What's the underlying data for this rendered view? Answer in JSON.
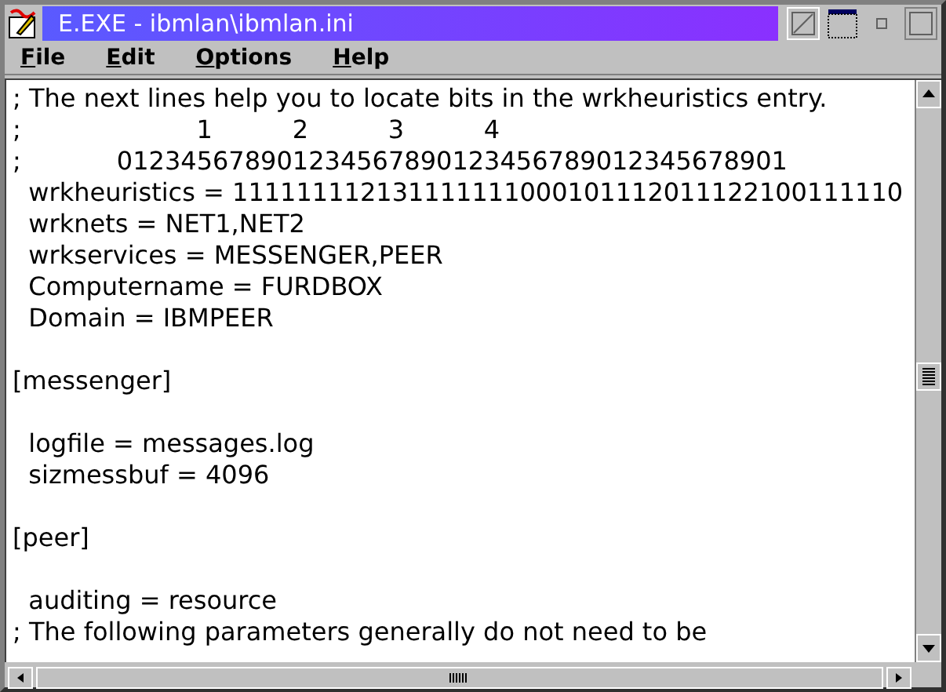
{
  "window": {
    "title": "E.EXE - ibmlan\\ibmlan.ini"
  },
  "menu": [
    "File",
    "Edit",
    "Options",
    "Help"
  ],
  "lines": [
    {
      "kind": "text",
      "text": "; The next lines help you to locate bits in the wrkheuristics entry."
    },
    {
      "kind": "text",
      "text": ";                      1          2          3          4"
    },
    {
      "kind": "text",
      "text": ";            012345678901234567890123456789012345678901"
    },
    {
      "kind": "text",
      "text": "  wrkheuristics = 111111112131111111000101112011122100111110"
    },
    {
      "kind": "text",
      "text": "  wrknets = NET1,NET2"
    },
    {
      "kind": "text",
      "text": "  wrkservices = MESSENGER,PEER"
    },
    {
      "kind": "text",
      "text": "  Computername = FURDBOX"
    },
    {
      "kind": "text",
      "text": "  Domain = IBMPEER"
    },
    {
      "kind": "blank"
    },
    {
      "kind": "text",
      "text": "[messenger]"
    },
    {
      "kind": "blank"
    },
    {
      "kind": "text",
      "text": "  logfile = messages.log"
    },
    {
      "kind": "text",
      "text": "  sizmessbuf = 4096"
    },
    {
      "kind": "blank"
    },
    {
      "kind": "text",
      "text": "[peer]"
    },
    {
      "kind": "blank"
    },
    {
      "kind": "text",
      "text": "  auditing = resource"
    },
    {
      "kind": "text",
      "text": "; The following parameters generally do not need to be"
    }
  ]
}
